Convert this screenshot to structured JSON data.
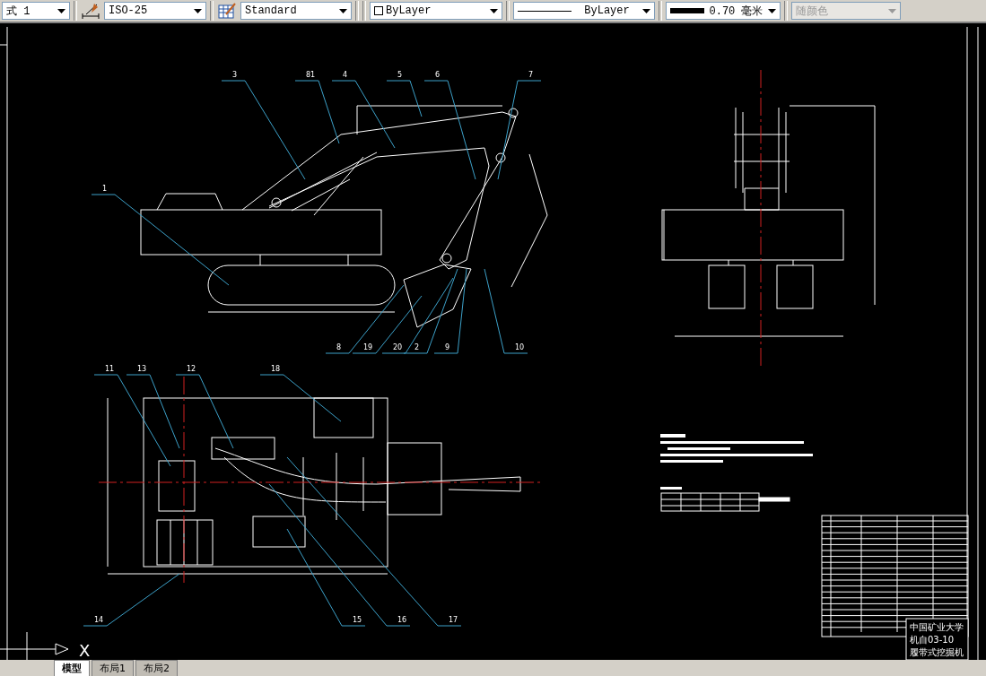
{
  "toolbar": {
    "text_style": "式 1",
    "dim_style": "ISO-25",
    "table_style": "Standard",
    "color_control": "ByLayer",
    "linetype": "ByLayer",
    "lineweight": "0.70 毫米",
    "plot_style": {
      "label": "随颜色",
      "disabled": true
    }
  },
  "drawing": {
    "side_view_labels": [
      "3",
      "81",
      "4",
      "5",
      "6",
      "7",
      "1",
      "8",
      "19",
      "20",
      "2",
      "9",
      "10"
    ],
    "top_view_labels": [
      "11",
      "13",
      "12",
      "18",
      "14",
      "15",
      "16",
      "17"
    ],
    "title_block": [
      "中国矿业大学",
      "机自03-10",
      "履带式挖掘机"
    ],
    "ucs_axis": "X"
  },
  "layout_tabs": [
    {
      "label": "模型",
      "selected": true
    },
    {
      "label": "布局1",
      "selected": false
    },
    {
      "label": "布局2",
      "selected": false
    }
  ]
}
